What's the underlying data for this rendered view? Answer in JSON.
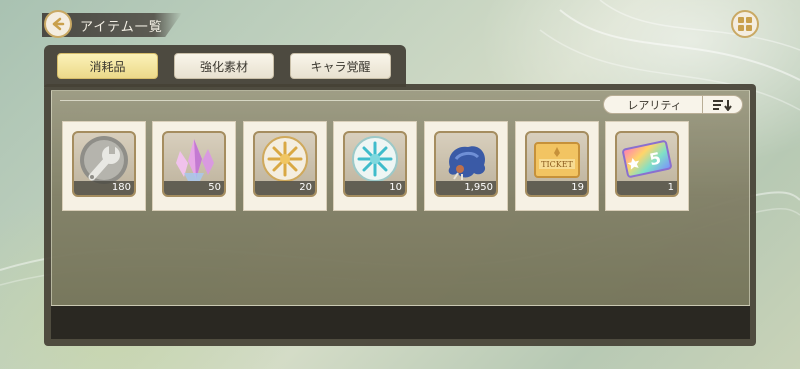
{
  "header": {
    "title": "アイテム一覧"
  },
  "tabs": [
    {
      "label": "消耗品",
      "active": true
    },
    {
      "label": "強化素材",
      "active": false
    },
    {
      "label": "キャラ覚醒",
      "active": false
    }
  ],
  "sort": {
    "label": "レアリティ"
  },
  "items": [
    {
      "icon": "wrench-icon",
      "count": "180"
    },
    {
      "icon": "pink-crystal-icon",
      "count": "50"
    },
    {
      "icon": "gold-medal-icon",
      "count": "20"
    },
    {
      "icon": "cyan-medal-icon",
      "count": "10"
    },
    {
      "icon": "blue-beast-icon",
      "count": "1,950"
    },
    {
      "icon": "ticket-icon",
      "count": "19",
      "ticket_text": "TICKET"
    },
    {
      "icon": "rainbow-ticket-icon",
      "count": "1",
      "ticket_number": "5"
    }
  ],
  "colors": {
    "panel": "#4d4a40",
    "accent_gold": "#c9a964",
    "active_tab": "#f2e39c"
  }
}
